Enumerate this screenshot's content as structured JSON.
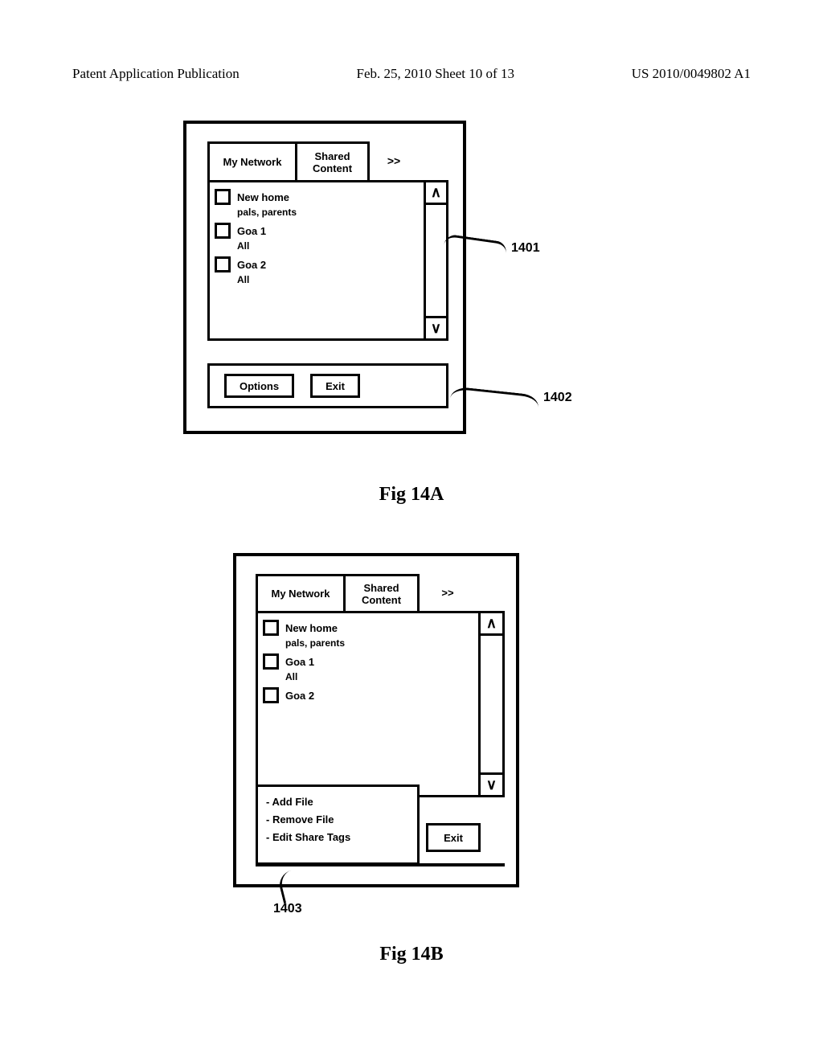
{
  "header": {
    "left": "Patent Application Publication",
    "center": "Feb. 25, 2010  Sheet 10 of 13",
    "right": "US 2010/0049802 A1"
  },
  "figA": {
    "tab_my": "My Network",
    "tab_sc_line1": "Shared",
    "tab_sc_line2": "Content",
    "tab_more": ">>",
    "scroll_up": "∧",
    "scroll_down": "∨",
    "items": [
      {
        "title": "New home",
        "sub": "pals, parents"
      },
      {
        "title": "Goa 1",
        "sub": "All"
      },
      {
        "title": "Goa 2",
        "sub": "All"
      }
    ],
    "btn_options": "Options",
    "btn_exit": "Exit",
    "callout1": "1401",
    "callout2": "1402",
    "caption": "Fig 14A"
  },
  "figB": {
    "tab_my": "My Network",
    "tab_sc_line1": "Shared",
    "tab_sc_line2": "Content",
    "tab_more": ">>",
    "scroll_up": "∧",
    "scroll_down": "∨",
    "items": [
      {
        "title": "New home",
        "sub": "pals, parents"
      },
      {
        "title": "Goa 1",
        "sub": "All"
      },
      {
        "title": "Goa 2",
        "sub": ""
      }
    ],
    "popup": {
      "line1": "- Add File",
      "line2": "- Remove File",
      "line3": "- Edit Share Tags"
    },
    "btn_exit": "Exit",
    "callout": "1403",
    "caption": "Fig 14B"
  }
}
